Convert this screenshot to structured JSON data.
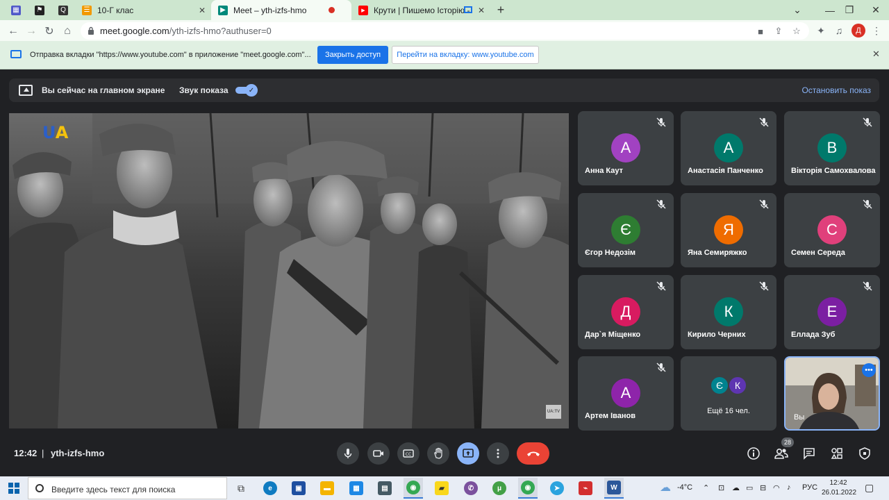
{
  "browser": {
    "tabs": [
      {
        "label": "",
        "icon": "ms-teams-icon",
        "color": "#5059c9"
      },
      {
        "label": "",
        "icon": "flag-icon",
        "color": "#222222"
      },
      {
        "label": "",
        "icon": "q-app-icon",
        "color": "#333333"
      },
      {
        "label": "10-Г клас",
        "icon": "classroom-icon",
        "color": "#f29900"
      },
      {
        "label": "Meet – yth-izfs-hmo",
        "icon": "meet-icon",
        "color": "#00897b"
      },
      {
        "label": "Крути | Пишемо Історію - Y",
        "icon": "youtube-icon",
        "color": "#ff0000"
      }
    ],
    "url_host": "meet.google.com",
    "url_path": "/yth-izfs-hmo?authuser=0",
    "profile_initial": "Д"
  },
  "infobar": {
    "message": "Отправка вкладки \"https://www.youtube.com\" в приложение \"meet.google.com\"...",
    "close_access": "Закрыть доступ",
    "switch_tab": "Перейти на вкладку: www.youtube.com"
  },
  "presenting": {
    "status": "Вы сейчас на главном экране",
    "audio_label": "Звук показа",
    "audio_on": true,
    "stop_label": "Остановить показ"
  },
  "stage": {
    "logo_u": "U",
    "logo_a": "A",
    "watermark": "UA:TV"
  },
  "participants": [
    {
      "initial": "А",
      "name": "Анна Каут",
      "color": "#a142c1"
    },
    {
      "initial": "А",
      "name": "Анастасія Панченко",
      "color": "#00796b"
    },
    {
      "initial": "В",
      "name": "Вікторія Самохвалова",
      "color": "#00796b"
    },
    {
      "initial": "Є",
      "name": "Єгор Недозім",
      "color": "#2e7d32"
    },
    {
      "initial": "Я",
      "name": "Яна Семиряжко",
      "color": "#ef6c00"
    },
    {
      "initial": "С",
      "name": "Семен Середа",
      "color": "#e0407b"
    },
    {
      "initial": "Д",
      "name": "Дар`я Міщенко",
      "color": "#d81b60"
    },
    {
      "initial": "К",
      "name": "Кирило Черних",
      "color": "#00796b"
    },
    {
      "initial": "Е",
      "name": "Еллада Зуб",
      "color": "#7b1fa2"
    },
    {
      "initial": "А",
      "name": "Артем Іванов",
      "color": "#8e24aa"
    }
  ],
  "more_tile": {
    "label": "Ещё 16 чел.",
    "avatars": [
      {
        "initial": "Є",
        "color": "#00838f"
      },
      {
        "initial": "К",
        "color": "#5e35b1"
      }
    ]
  },
  "self_tile": {
    "name": "Вы"
  },
  "meeting": {
    "time": "12:42",
    "separator": "|",
    "code": "yth-izfs-hmo",
    "participant_count": "28"
  },
  "taskbar": {
    "search_placeholder": "Введите здесь текст для поиска",
    "weather": "-4°C",
    "language": "РУС",
    "time": "12:42",
    "date": "26.01.2022",
    "apps": [
      {
        "icon": "task-view-icon",
        "label": "",
        "color": "#333333"
      },
      {
        "icon": "edge-icon",
        "label": "",
        "color": "#0f7bc1"
      },
      {
        "icon": "save-app-icon",
        "label": "",
        "color": "#1e4fa0"
      },
      {
        "icon": "file-explorer-icon",
        "label": "",
        "color": "#f4b400"
      },
      {
        "icon": "calendar-app-icon",
        "label": "",
        "color": "#1e88e5"
      },
      {
        "icon": "calculator-icon",
        "label": "",
        "color": "#455a64"
      },
      {
        "icon": "chrome-icon",
        "label": "",
        "color": "#34a853"
      },
      {
        "icon": "sticky-notes-icon",
        "label": "",
        "color": "#f9d71c"
      },
      {
        "icon": "viber-icon",
        "label": "",
        "color": "#7b519d"
      },
      {
        "icon": "torrent-icon",
        "label": "",
        "color": "#43a047"
      },
      {
        "icon": "chrome-profile-icon",
        "label": "",
        "color": "#34a853"
      },
      {
        "icon": "telegram-icon",
        "label": "",
        "color": "#2aa3de"
      },
      {
        "icon": "acrobat-icon",
        "label": "",
        "color": "#d32f2f"
      },
      {
        "icon": "word-icon",
        "label": "W",
        "color": "#2b579a"
      }
    ]
  }
}
